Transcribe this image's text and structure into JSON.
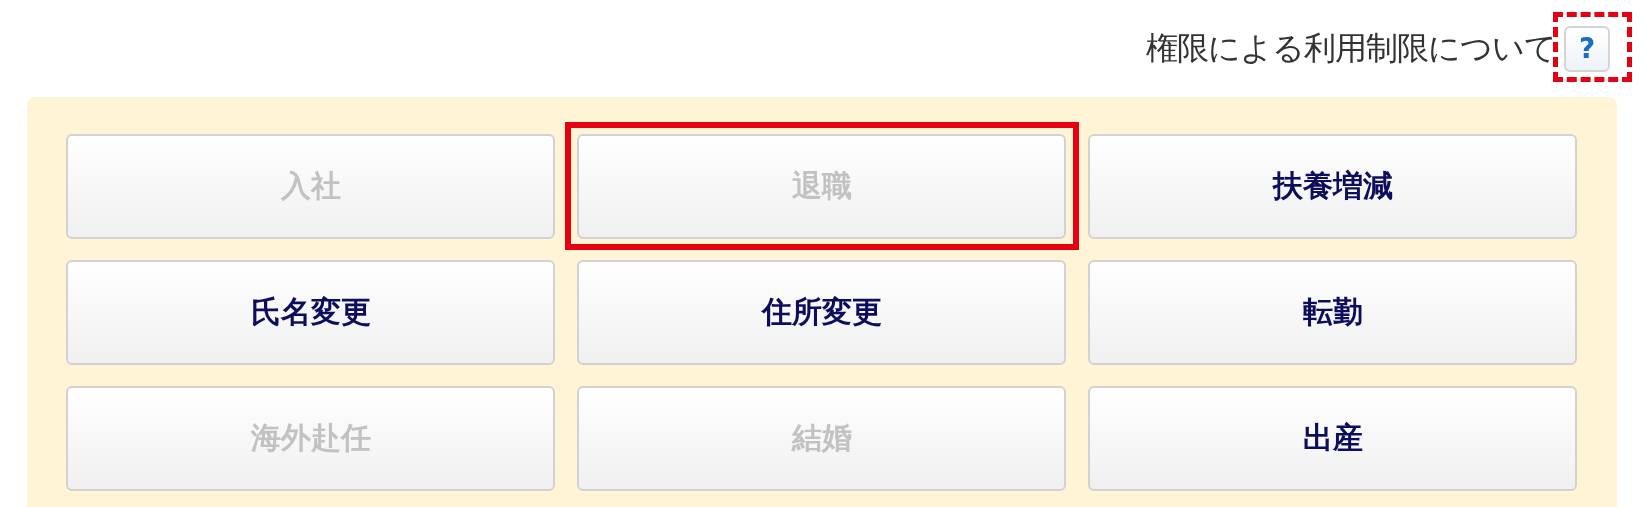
{
  "help": {
    "label": "権限による利用制限について",
    "button": "?",
    "highlighted": true
  },
  "buttons": [
    {
      "label": "入社",
      "disabled": true,
      "highlighted": false
    },
    {
      "label": "退職",
      "disabled": true,
      "highlighted": true
    },
    {
      "label": "扶養増減",
      "disabled": false,
      "highlighted": false
    },
    {
      "label": "氏名変更",
      "disabled": false,
      "highlighted": false
    },
    {
      "label": "住所変更",
      "disabled": false,
      "highlighted": false
    },
    {
      "label": "転勤",
      "disabled": false,
      "highlighted": false
    },
    {
      "label": "海外赴任",
      "disabled": true,
      "highlighted": false
    },
    {
      "label": "結婚",
      "disabled": true,
      "highlighted": false
    },
    {
      "label": "出産",
      "disabled": false,
      "highlighted": false
    }
  ]
}
